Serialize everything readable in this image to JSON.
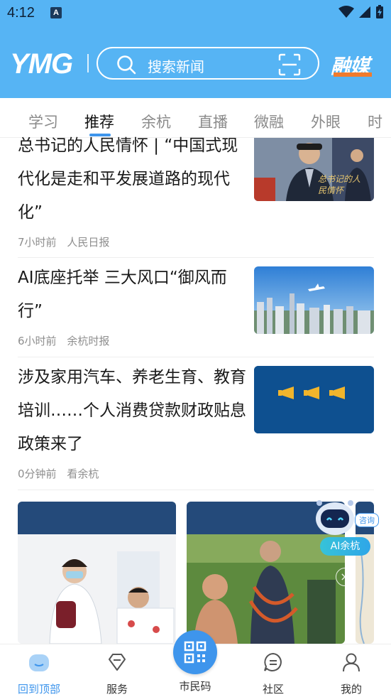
{
  "status_bar": {
    "time": "4:12",
    "app_icon_letter": "A"
  },
  "header": {
    "logo": "YMG",
    "search_placeholder": "搜索新闻",
    "brand_right": "融媒",
    "accent_color": "#56b4f4"
  },
  "tabs": [
    {
      "label": "学习",
      "active": false
    },
    {
      "label": "推荐",
      "active": true
    },
    {
      "label": "余杭",
      "active": false
    },
    {
      "label": "直播",
      "active": false
    },
    {
      "label": "微融",
      "active": false
    },
    {
      "label": "外眼",
      "active": false
    },
    {
      "label": "时",
      "active": false
    }
  ],
  "news": [
    {
      "title": "总书记的人民情怀 | “中国式现代化是走和平发展道路的现代化”",
      "time": "7小时前",
      "source": "人民日报",
      "thumb_caption": "总书记的人民情怀"
    },
    {
      "title": "AI底座托举 三大风口“御风而行”",
      "time": "6小时前",
      "source": "余杭时报"
    },
    {
      "title": "涉及家用汽车、养老生育、教育培训……个人消费贷款财政贴息政策来了",
      "time": "0分钟前",
      "source": "看余杭"
    }
  ],
  "ai_assistant": {
    "consult": "咨询",
    "label": "AI余杭"
  },
  "bottom_nav": [
    {
      "label": "回到顶部",
      "icon": "back-to-top-icon",
      "active": true
    },
    {
      "label": "服务",
      "icon": "diamond-icon",
      "active": false
    },
    {
      "label": "市民码",
      "icon": "qr-code-icon",
      "active": false
    },
    {
      "label": "社区",
      "icon": "chat-bubble-icon",
      "active": false
    },
    {
      "label": "我的",
      "icon": "person-icon",
      "active": false
    }
  ]
}
